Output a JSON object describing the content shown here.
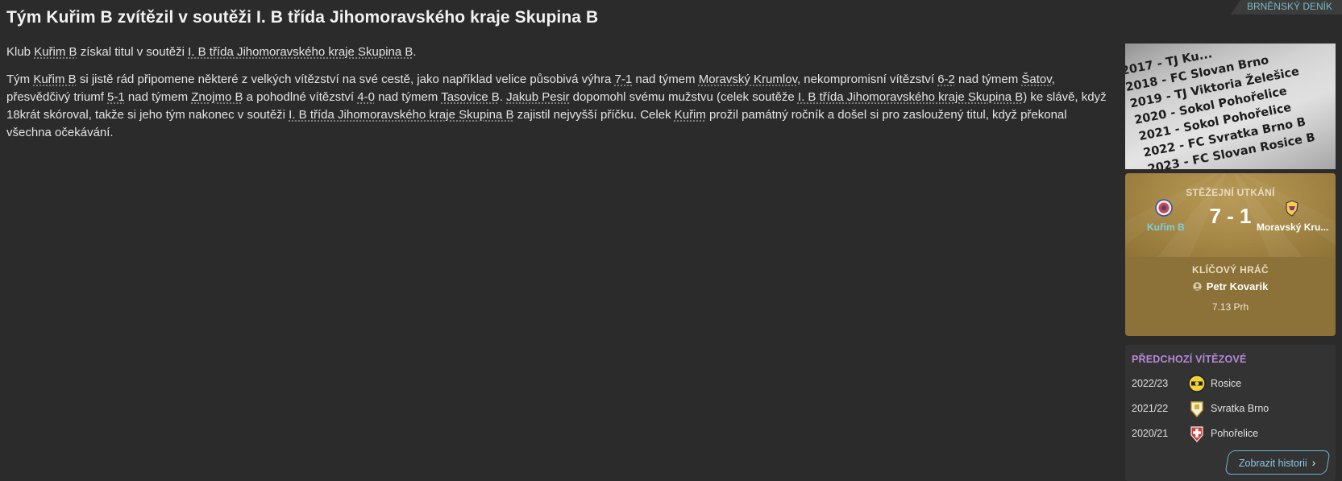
{
  "header": {
    "title": "Tým Kuřim B zvítězil v soutěži I. B třída Jihomoravského kraje Skupina B",
    "source_badge": "BRNĚNSKÝ DENÍK"
  },
  "article": {
    "p1": [
      "Klub ",
      {
        "link": "Kuřim B"
      },
      " získal titul v soutěži ",
      {
        "link": "I. B třída Jihomoravského kraje Skupina B"
      },
      "."
    ],
    "p2": [
      "Tým ",
      {
        "link": "Kuřim B"
      },
      " si jistě rád připomene některé z velkých vítězství na své cestě, jako například velice působivá výhra ",
      {
        "link": "7-1"
      },
      " nad týmem ",
      {
        "link": "Moravský Krumlov"
      },
      ", nekompromisní vítězství ",
      {
        "link": "6-2"
      },
      " nad týmem ",
      {
        "link": "Šatov"
      },
      ", přesvědčivý triumf ",
      {
        "link": "5-1"
      },
      " nad týmem ",
      {
        "link": "Znojmo B"
      },
      " a pohodlné vítězství ",
      {
        "link": "4-0"
      },
      " nad týmem ",
      {
        "link": "Tasovice B"
      },
      ". ",
      {
        "link": "Jakub Pesir"
      },
      " dopomohl svému mužstvu (celek soutěže ",
      {
        "link": "I. B třída Jihomoravského kraje Skupina B"
      },
      ") ke slávě, když 18krát skóroval, takže si jeho tým nakonec v soutěži ",
      {
        "link": "I. B třída Jihomoravského kraje Skupina B"
      },
      " zajistil nejvyšší příčku. Celek ",
      {
        "link": "Kuřim"
      },
      " prožil památný ročník a došel si pro zasloužený titul, když překonal všechna očekávání."
    ]
  },
  "photo": {
    "lines": [
      "2017 - TJ Ku...",
      "2018 - FC Slovan Brno",
      "2019 - TJ Viktoria Želešice",
      "2020 - Sokol Pohořelice",
      "2021 - Sokol Pohořelice",
      "2022 - FC Svratka Brno B",
      "2023 - FC Slovan Rosice B"
    ]
  },
  "key_match": {
    "label": "STĚŽEJNÍ UTKÁNÍ",
    "home_team": "Kuřim B",
    "away_team": "Moravský Kru...",
    "score": "7 - 1",
    "home_color": "#7fd0e0",
    "key_player_label": "KLÍČOVÝ HRÁČ",
    "key_player_name": "Petr Kovarik",
    "key_player_rating": "7.13 Prh"
  },
  "previous_winners": {
    "title": "PŘEDCHOZÍ VÍTĚZOVÉ",
    "rows": [
      {
        "season": "2022/23",
        "club": "Rosice",
        "crest": "rosice-crest"
      },
      {
        "season": "2021/22",
        "club": "Svratka Brno",
        "crest": "svratka-crest"
      },
      {
        "season": "2020/21",
        "club": "Pohořelice",
        "crest": "pohorelice-crest"
      }
    ],
    "history_button": "Zobrazit historii"
  },
  "colors": {
    "background": "#2b2b2b",
    "accent_purple": "#b58ad8",
    "accent_blue": "#6fb5d6",
    "gold_panel": "#8c7238"
  }
}
